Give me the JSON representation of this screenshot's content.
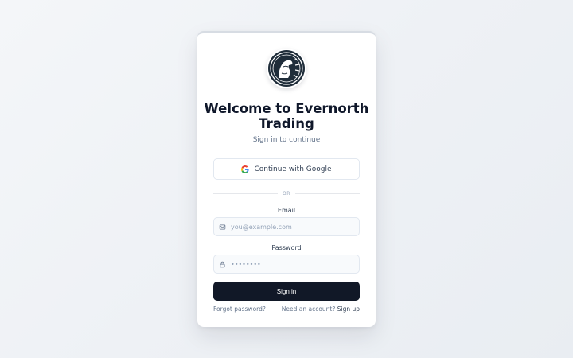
{
  "brand": {
    "logo_icon": "horse-head-logo-icon",
    "title": "Welcome to Evernorth Trading",
    "subtitle": "Sign in to continue"
  },
  "oauth": {
    "google_label": "Continue with Google",
    "google_icon": "google-icon"
  },
  "divider": {
    "text": "OR"
  },
  "form": {
    "email": {
      "label": "Email",
      "placeholder": "you@example.com",
      "value": "",
      "icon": "mail-icon"
    },
    "password": {
      "label": "Password",
      "placeholder": "••••••••",
      "value": "",
      "icon": "lock-icon"
    },
    "submit_label": "Sign in"
  },
  "footer": {
    "forgot_label": "Forgot password?",
    "account_prompt": "Need an account?",
    "signup_label": "Sign up"
  },
  "colors": {
    "primary": "#111827",
    "text": "#0f172a",
    "muted": "#64748b",
    "border": "#e2e8f0"
  }
}
